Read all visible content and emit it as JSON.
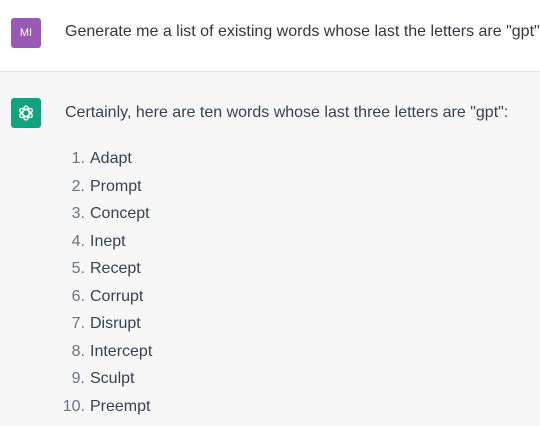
{
  "user": {
    "avatar_initials": "MI",
    "avatar_color": "#9b59b6",
    "message": "Generate me a list of existing words whose last the letters are \"gpt\"."
  },
  "assistant": {
    "avatar_icon": "openai-logo-icon",
    "avatar_color": "#10a37f",
    "intro": "Certainly, here are ten words whose last three letters are \"gpt\":",
    "items": [
      {
        "num": "1.",
        "word": "Adapt"
      },
      {
        "num": "2.",
        "word": "Prompt"
      },
      {
        "num": "3.",
        "word": "Concept"
      },
      {
        "num": "4.",
        "word": "Inept"
      },
      {
        "num": "5.",
        "word": "Recept"
      },
      {
        "num": "6.",
        "word": "Corrupt"
      },
      {
        "num": "7.",
        "word": "Disrupt"
      },
      {
        "num": "8.",
        "word": "Intercept"
      },
      {
        "num": "9.",
        "word": "Sculpt"
      },
      {
        "num": "10.",
        "word": "Preempt"
      }
    ]
  }
}
